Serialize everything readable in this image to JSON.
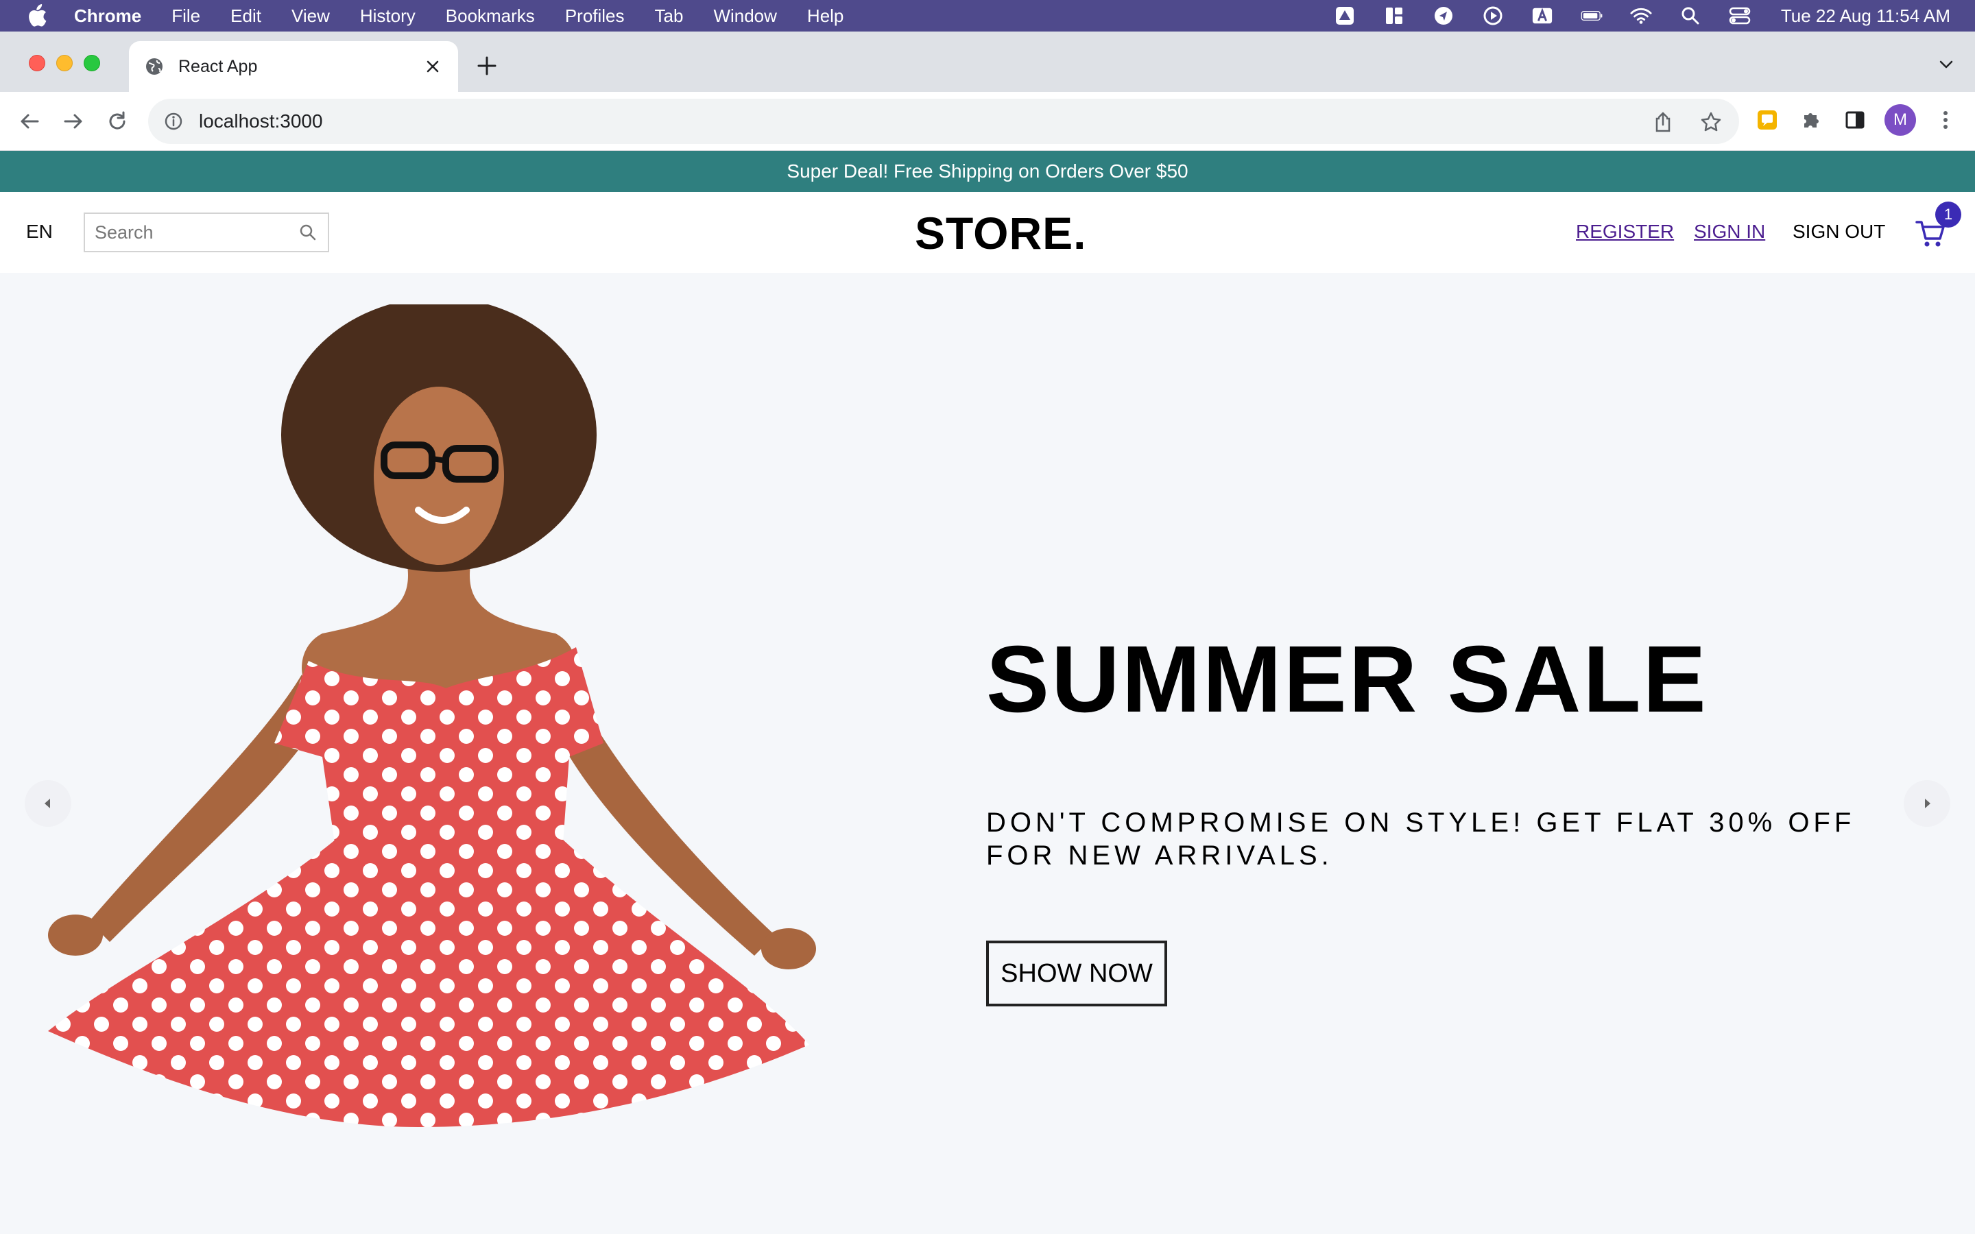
{
  "menubar": {
    "app_name": "Chrome",
    "items": [
      "File",
      "Edit",
      "View",
      "History",
      "Bookmarks",
      "Profiles",
      "Tab",
      "Window",
      "Help"
    ],
    "clock": "Tue 22 Aug  11:54 AM"
  },
  "browser": {
    "tab_title": "React App",
    "url": "localhost:3000",
    "profile_initial": "M"
  },
  "announcement": "Super Deal! Free Shipping on Orders Over $50",
  "navbar": {
    "language": "EN",
    "search_placeholder": "Search",
    "logo": "STORE.",
    "register": "REGISTER",
    "sign_in": "SIGN IN",
    "sign_out": "SIGN OUT",
    "cart_count": "1"
  },
  "hero": {
    "title": "SUMMER SALE",
    "description": "DON'T COMPROMISE ON STYLE! GET FLAT 30% OFF FOR NEW ARRIVALS.",
    "button": "SHOW NOW"
  },
  "colors": {
    "menubar_bg": "#4f4a8c",
    "announcement_bg": "#2f7f7f",
    "link": "#4b1d8f",
    "badge": "#3b2bb5",
    "dress": "#e2504f"
  }
}
